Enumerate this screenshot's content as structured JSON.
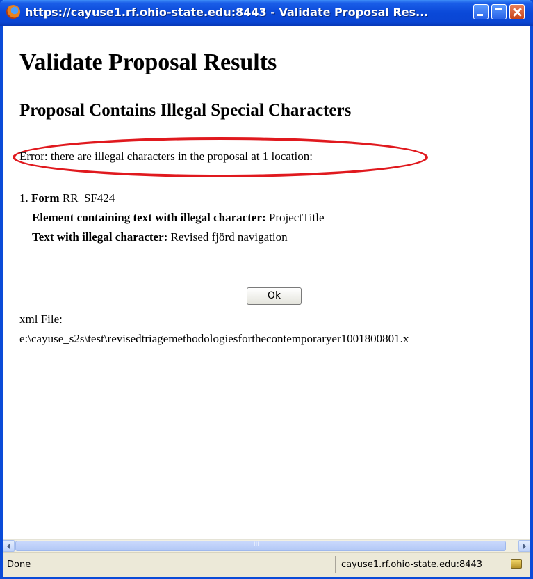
{
  "window": {
    "title": "https://cayuse1.rf.ohio-state.edu:8443 - Validate Proposal Res..."
  },
  "page": {
    "heading": "Validate Proposal Results",
    "subheading": "Proposal Contains Illegal Special Characters",
    "error_message": "Error: there are illegal characters in the proposal at 1 location:",
    "item": {
      "number": "1.",
      "form_label": "Form",
      "form_value": "RR_SF424",
      "element_label": "Element containing text with illegal character:",
      "element_value": "ProjectTitle",
      "text_label": "Text with illegal character:",
      "text_value": "Revised fjörd navigation"
    },
    "ok_button": "Ok",
    "xml_label": "xml File:",
    "xml_path": "e:\\cayuse_s2s\\test\\revisedtriagemethodologiesforthecontemporaryer1001800801.x"
  },
  "statusbar": {
    "status": "Done",
    "host": "cayuse1.rf.ohio-state.edu:8443"
  },
  "colors": {
    "titlebar": "#0a48d8",
    "highlight_ellipse": "#e0191e",
    "statusbar": "#ece9d8"
  },
  "icons": [
    "firefox-icon",
    "minimize-icon",
    "maximize-icon",
    "close-icon",
    "scroll-left-icon",
    "scroll-right-icon",
    "lock-icon"
  ]
}
